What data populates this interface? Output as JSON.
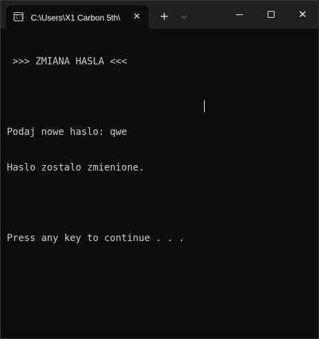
{
  "window": {
    "tab_title": "C:\\Users\\X1 Carbon 5th\\",
    "tab_icon": "terminal-icon",
    "tab_close_glyph": "✕",
    "new_tab_glyph": "+",
    "dropdown_glyph": "⌵",
    "controls": [
      "minimize",
      "maximize",
      "close"
    ],
    "close_glyph": "✕"
  },
  "console": {
    "lines": [
      " >>> ZMIANA HASLA <<<",
      "",
      "Podaj nowe haslo: qwe",
      "Haslo zostalo zmienione.",
      "",
      "Press any key to continue . . ."
    ]
  },
  "colors": {
    "background": "#0c0c0c",
    "titlebar": "#202020",
    "text": "#cccccc"
  }
}
